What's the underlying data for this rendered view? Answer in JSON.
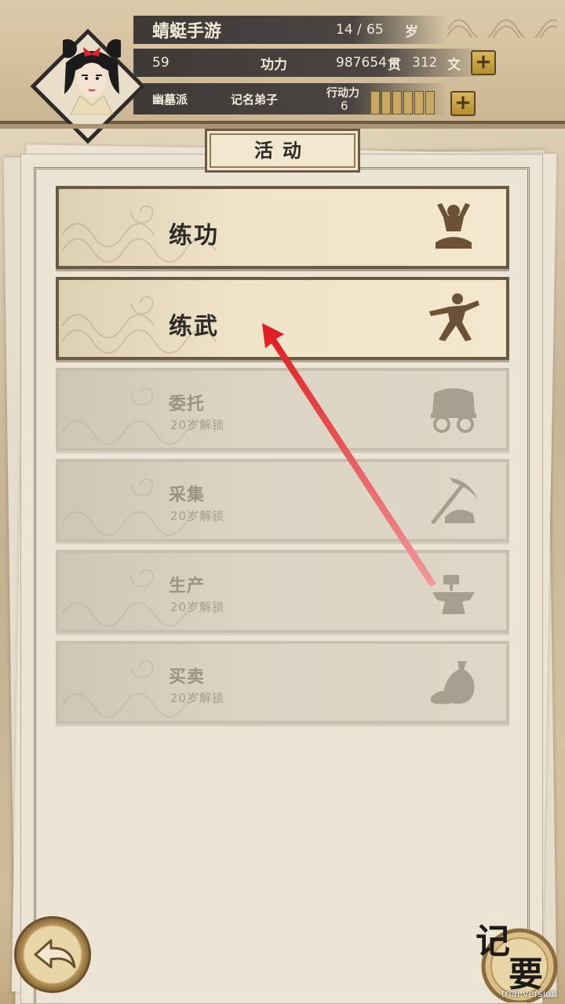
{
  "header": {
    "player_name": "蜻蜓手游",
    "age_current": "14",
    "age_separator": "/",
    "age_max": "65",
    "age_unit": "岁",
    "gongli_value": "59",
    "gongli_label": "功力",
    "money_guan_value": "987654",
    "money_guan_unit": "贯",
    "money_wen_value": "312",
    "money_wen_unit": "文",
    "sect": "幽墓派",
    "rank": "记名弟子",
    "action_power_label": "行动力",
    "action_power_value": "6",
    "action_power_slots": 6,
    "add_money_label": "+",
    "add_action_label": "+"
  },
  "panel": {
    "title": "活动"
  },
  "activities": [
    {
      "label": "练功",
      "locked": false,
      "sublabel": "",
      "icon": "meditation-icon"
    },
    {
      "label": "练武",
      "locked": false,
      "sublabel": "",
      "icon": "martial-arts-icon"
    },
    {
      "label": "委托",
      "locked": true,
      "sublabel": "20岁解锁",
      "icon": "wagon-icon"
    },
    {
      "label": "采集",
      "locked": true,
      "sublabel": "20岁解锁",
      "icon": "pickaxe-icon"
    },
    {
      "label": "生产",
      "locked": true,
      "sublabel": "20岁解锁",
      "icon": "anvil-icon"
    },
    {
      "label": "买卖",
      "locked": true,
      "sublabel": "20岁解锁",
      "icon": "money-bag-icon"
    }
  ],
  "footer": {
    "memo_char_1": "记",
    "memo_char_2": "要",
    "watermark": "trial version"
  },
  "colors": {
    "frame_brown": "#6b5a42",
    "stat_bar": "#3e3a37",
    "arrow_red": "#e0191e",
    "gold_button": "#c9a040"
  }
}
